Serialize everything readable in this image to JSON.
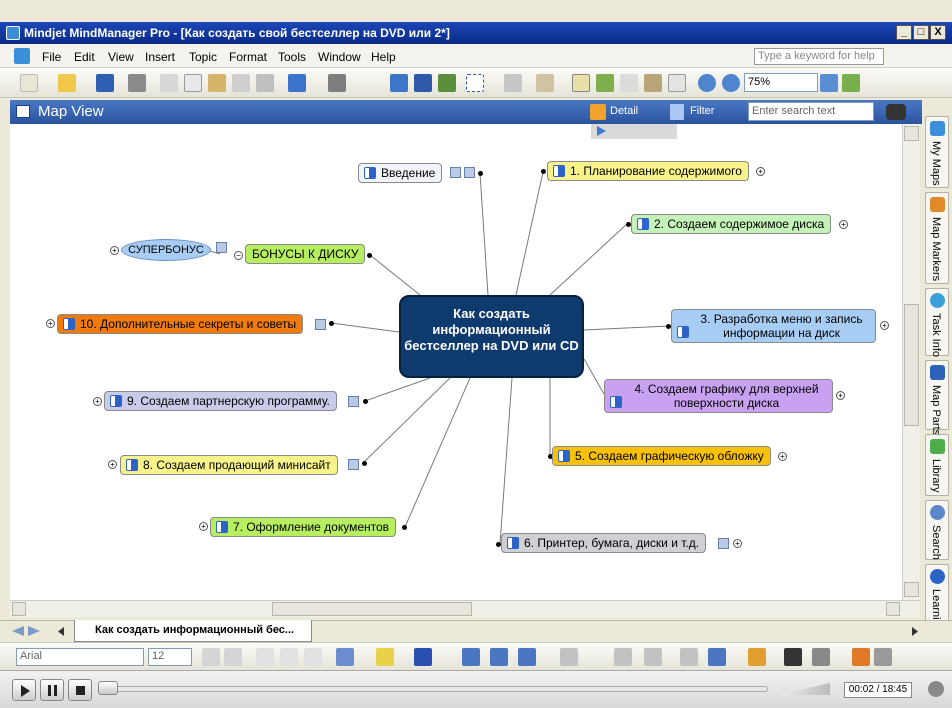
{
  "window": {
    "title": "Mindjet MindManager Pro - [Как создать свой бестселлер на DVD или 2*]",
    "min_label": "_",
    "max_label": "□",
    "close_label": "X"
  },
  "menu": {
    "items": [
      "File",
      "Edit",
      "View",
      "Insert",
      "Topic",
      "Format",
      "Tools",
      "Window",
      "Help"
    ],
    "help_placeholder": "Type a keyword for help"
  },
  "toolbar": {
    "zoom": "75%"
  },
  "mapview": {
    "title": "Map View",
    "detail_label": "Detail",
    "filter_label": "Filter",
    "search_placeholder": "Enter search text"
  },
  "map": {
    "central": "Как создать информационный бестселлер на DVD или CD",
    "topics": [
      {
        "label": "Введение"
      },
      {
        "label": "1. Планирование содержимого"
      },
      {
        "label": "2. Создаем содержимое диска"
      },
      {
        "label": "3. Разработка меню и запись информации на диск"
      },
      {
        "label": "4. Создаем графику для верхней поверхности диска"
      },
      {
        "label": "5. Создаем графическую обложку"
      },
      {
        "label": "6. Принтер, бумага, диски и т.д."
      },
      {
        "label": "7. Оформление документов"
      },
      {
        "label": "8. Создаем продающий минисайт"
      },
      {
        "label": "9. Создаем партнерскую программу."
      },
      {
        "label": "10. Дополнительные секреты и советы"
      },
      {
        "label": "БОНУСЫ К ДИСКУ"
      }
    ],
    "superbonus": "СУПЕРБОНУС"
  },
  "side_tabs": [
    "My Maps",
    "Map Markers",
    "Task Info",
    "Map Parts",
    "Library",
    "Search",
    "Learning"
  ],
  "doc_tab": "Как создать информационный бес...",
  "format": {
    "font": "Arial",
    "size": "12"
  },
  "player": {
    "time": "00:02 / 18:45"
  },
  "colors": {
    "central": "#0e3a6e",
    "yellow": "#f7f38a",
    "green": "#c4f2b8",
    "blue": "#a8cdf5",
    "purple": "#c8a2f0",
    "orange_yellow": "#f7c10a",
    "gray": "#cfcfd4",
    "lime": "#b7ee60",
    "orange": "#f07a0e",
    "lavender": "#c9cce8"
  }
}
